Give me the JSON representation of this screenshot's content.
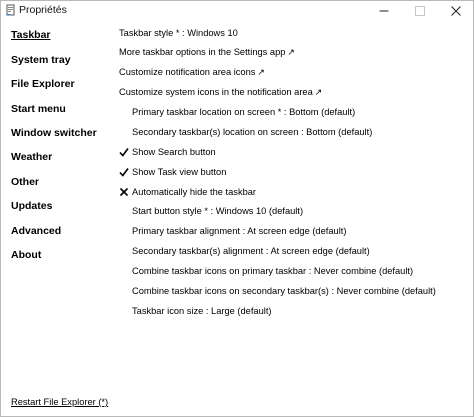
{
  "window": {
    "title": "Propriétés",
    "minimize_glyph": "—",
    "maximize_glyph": "☐",
    "close_glyph": "✕"
  },
  "sidebar": {
    "items": [
      {
        "label": "Taskbar",
        "active": true
      },
      {
        "label": "System tray"
      },
      {
        "label": "File Explorer"
      },
      {
        "label": "Start menu"
      },
      {
        "label": "Window switcher"
      },
      {
        "label": "Weather"
      },
      {
        "label": "Other"
      },
      {
        "label": "Updates"
      },
      {
        "label": "Advanced"
      },
      {
        "label": "About"
      }
    ]
  },
  "options": [
    {
      "label": "Taskbar style * : Windows 10"
    },
    {
      "label": "More taskbar options in the Settings app",
      "external": "↗"
    },
    {
      "label": "Customize notification area icons",
      "external": "↗"
    },
    {
      "label": "Customize system icons in the notification area",
      "external": "↗"
    },
    {
      "label": "Primary taskbar location on screen * : Bottom (default)"
    },
    {
      "label": "Secondary taskbar(s) location on screen : Bottom (default)"
    },
    {
      "label": "Show Search button",
      "state": "checked",
      "state_icon": "checkmark-icon"
    },
    {
      "label": "Show Task view button",
      "state": "checked",
      "state_icon": "checkmark-icon"
    },
    {
      "label": "Automatically hide the taskbar",
      "state": "unchecked",
      "state_icon": "cross-icon"
    },
    {
      "label": "Start button style * : Windows 10 (default)"
    },
    {
      "label": "Primary taskbar alignment : At screen edge (default)"
    },
    {
      "label": "Secondary taskbar(s) alignment : At screen edge (default)"
    },
    {
      "label": "Combine taskbar icons on primary taskbar : Never combine (default)"
    },
    {
      "label": "Combine taskbar icons on secondary taskbar(s) : Never combine (default)"
    },
    {
      "label": "Taskbar icon size : Large (default)"
    }
  ],
  "footer": {
    "restart_label": "Restart File Explorer (*)"
  },
  "colors": {
    "background": "#ffffff",
    "text": "#000000",
    "border": "#b9b9b9"
  }
}
